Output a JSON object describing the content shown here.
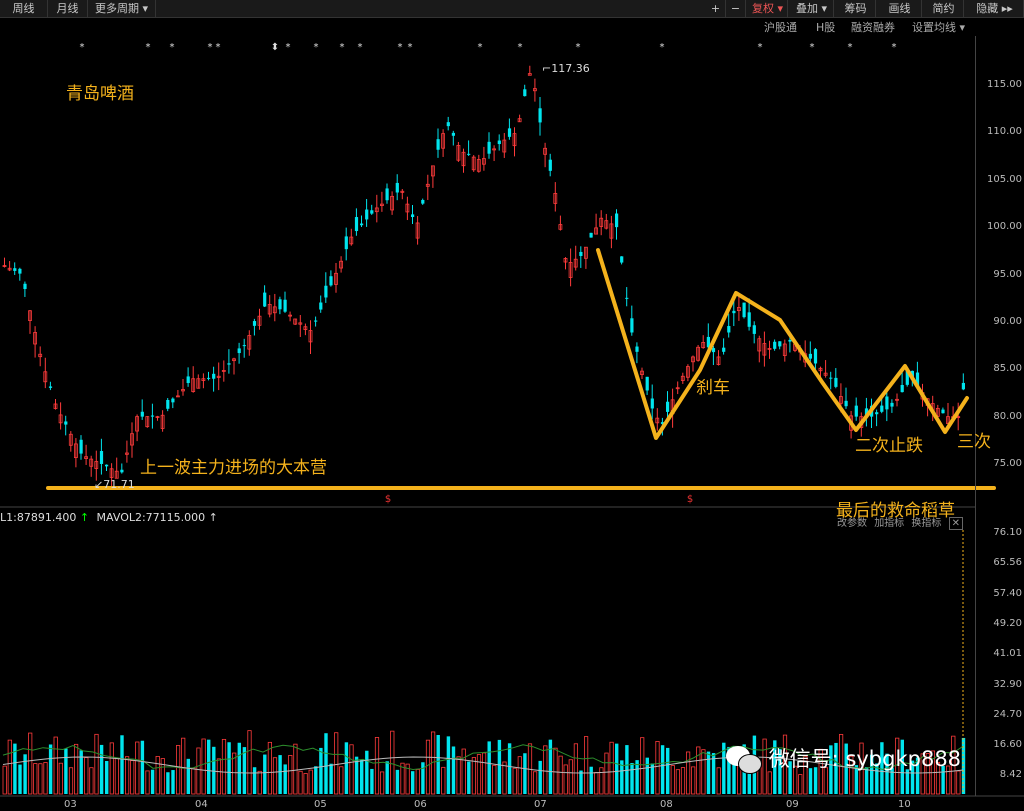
{
  "toolbar": {
    "left": [
      "周线",
      "月线",
      "更多周期"
    ],
    "right": [
      "+",
      "−",
      "复权",
      "叠加",
      "筹码",
      "画线",
      "简约",
      "隐藏"
    ],
    "active": "复权"
  },
  "subbar": [
    "沪股通",
    "H股",
    "融资融券",
    "设置均线"
  ],
  "stock_title": "青岛啤酒",
  "price_labels": {
    "high": "117.36",
    "low": "71.71"
  },
  "volume_legend": {
    "mavol1": "L1:87891.400",
    "mavol2": "MAVOL2:77115.000"
  },
  "volume_tools": [
    "改参数",
    "加指标",
    "换指标"
  ],
  "annotations": {
    "support": "上一波主力进场的大本营",
    "brake": "刹车",
    "second": "二次止跌",
    "third": "三次",
    "last": "最后的救命稻草"
  },
  "watermark": "微信号: sybgkp888",
  "colors": {
    "up": "#ff3b3b",
    "down": "#00e5ee",
    "annotation": "#f4b21c",
    "bg": "#000000"
  },
  "chart_data": {
    "type": "candlestick",
    "price_ticks": [
      "115.00",
      "110.00",
      "105.00",
      "100.00",
      "95.00",
      "90.00",
      "85.00",
      "80.00",
      "75.00"
    ],
    "volume_ticks": [
      "76.10",
      "65.56",
      "57.40",
      "49.20",
      "41.01",
      "32.90",
      "24.70",
      "16.60",
      "8.42"
    ],
    "months": [
      "03",
      "04",
      "05",
      "06",
      "07",
      "08",
      "09",
      "10"
    ],
    "high": 117.36,
    "low": 71.71
  }
}
